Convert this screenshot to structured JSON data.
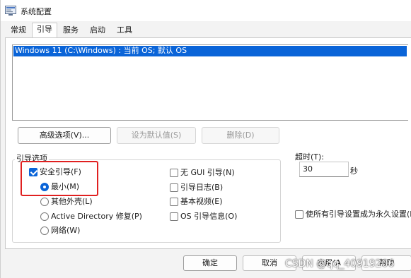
{
  "window": {
    "title": "系统配置"
  },
  "tabs": [
    {
      "label": "常规"
    },
    {
      "label": "引导"
    },
    {
      "label": "服务"
    },
    {
      "label": "启动"
    },
    {
      "label": "工具"
    }
  ],
  "os_list": {
    "entries": [
      "Windows 11 (C:\\Windows) : 当前 OS; 默认 OS"
    ]
  },
  "buttons": {
    "advanced": "高级选项(V)...",
    "set_default": "设为默认值(S)",
    "delete": "删除(D)"
  },
  "boot_options": {
    "group_label": "引导选项",
    "safe_boot": {
      "label": "安全引导(F)",
      "checked": true
    },
    "minimal": {
      "label": "最小(M)",
      "selected": true
    },
    "alternate_shell": {
      "label": "其他外壳(L)",
      "selected": false
    },
    "active_directory": {
      "label": "Active Directory 修复(P)",
      "selected": false
    },
    "network": {
      "label": "网络(W)",
      "selected": false
    },
    "no_gui": {
      "label": "无 GUI 引导(N)",
      "checked": false
    },
    "boot_log": {
      "label": "引导日志(B)",
      "checked": false
    },
    "base_video": {
      "label": "基本视频(E)",
      "checked": false
    },
    "os_boot_info": {
      "label": "OS 引导信息(O)",
      "checked": false
    }
  },
  "timeout": {
    "label": "超时(T):",
    "value": "30",
    "unit": "秒"
  },
  "make_permanent": {
    "label": "使所有引导设置成为永久设置(K",
    "checked": false
  },
  "footer": {
    "ok": "确定",
    "cancel": "取消",
    "apply": "应用(A",
    "help": "帮助"
  },
  "watermark": "CSDN @qq_40919206",
  "colors": {
    "accent": "#0a64d8",
    "highlight_border": "#e02020"
  }
}
